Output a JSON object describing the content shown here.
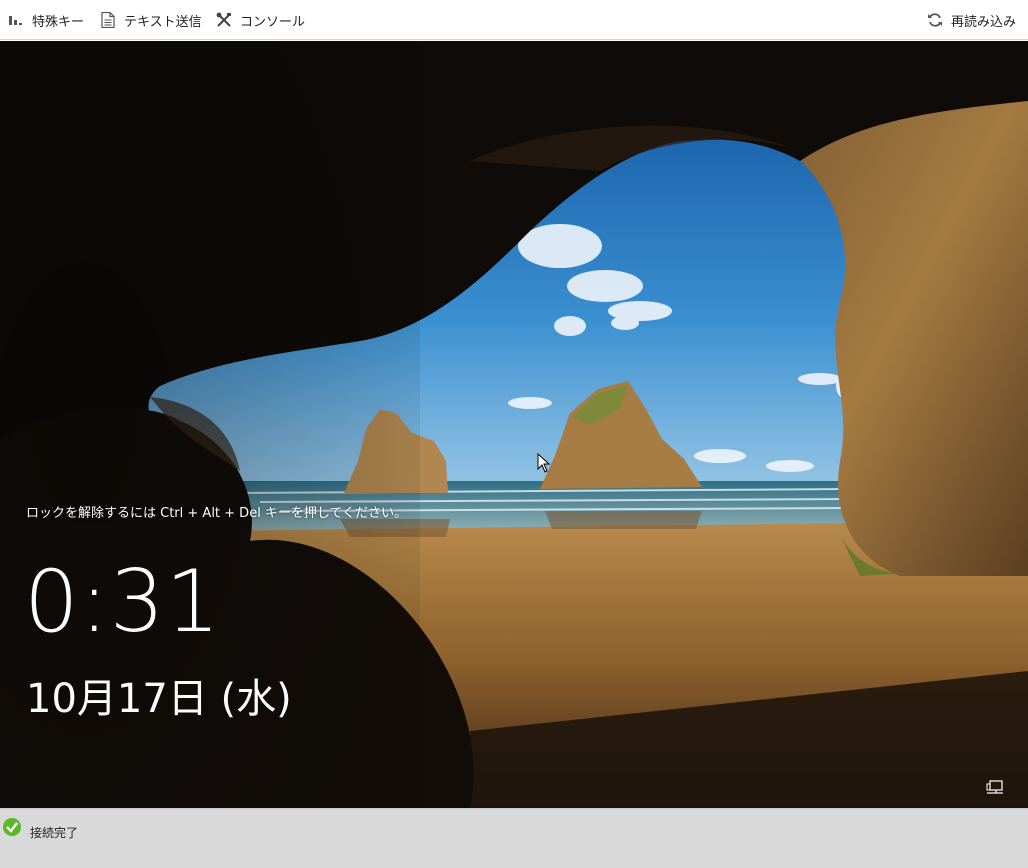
{
  "toolbar": {
    "special_keys_label": "特殊キー",
    "special_keys_icon": "bar-steps-icon",
    "send_text_label": "テキスト送信",
    "send_text_icon": "document-icon",
    "console_label": "コンソール",
    "console_icon": "tools-icon",
    "reload_label": "再読み込み",
    "reload_icon": "refresh-icon"
  },
  "lockscreen": {
    "hint": "ロックを解除するには Ctrl + Alt + Del キーを押してください。",
    "time": "0:31",
    "date": "10月17日 (水)",
    "network_icon": "network-icon",
    "cursor_icon": "mouse-pointer-icon"
  },
  "status": {
    "icon": "check-circle-icon",
    "text": "接続完了",
    "icon_color": "#5cb82a"
  }
}
